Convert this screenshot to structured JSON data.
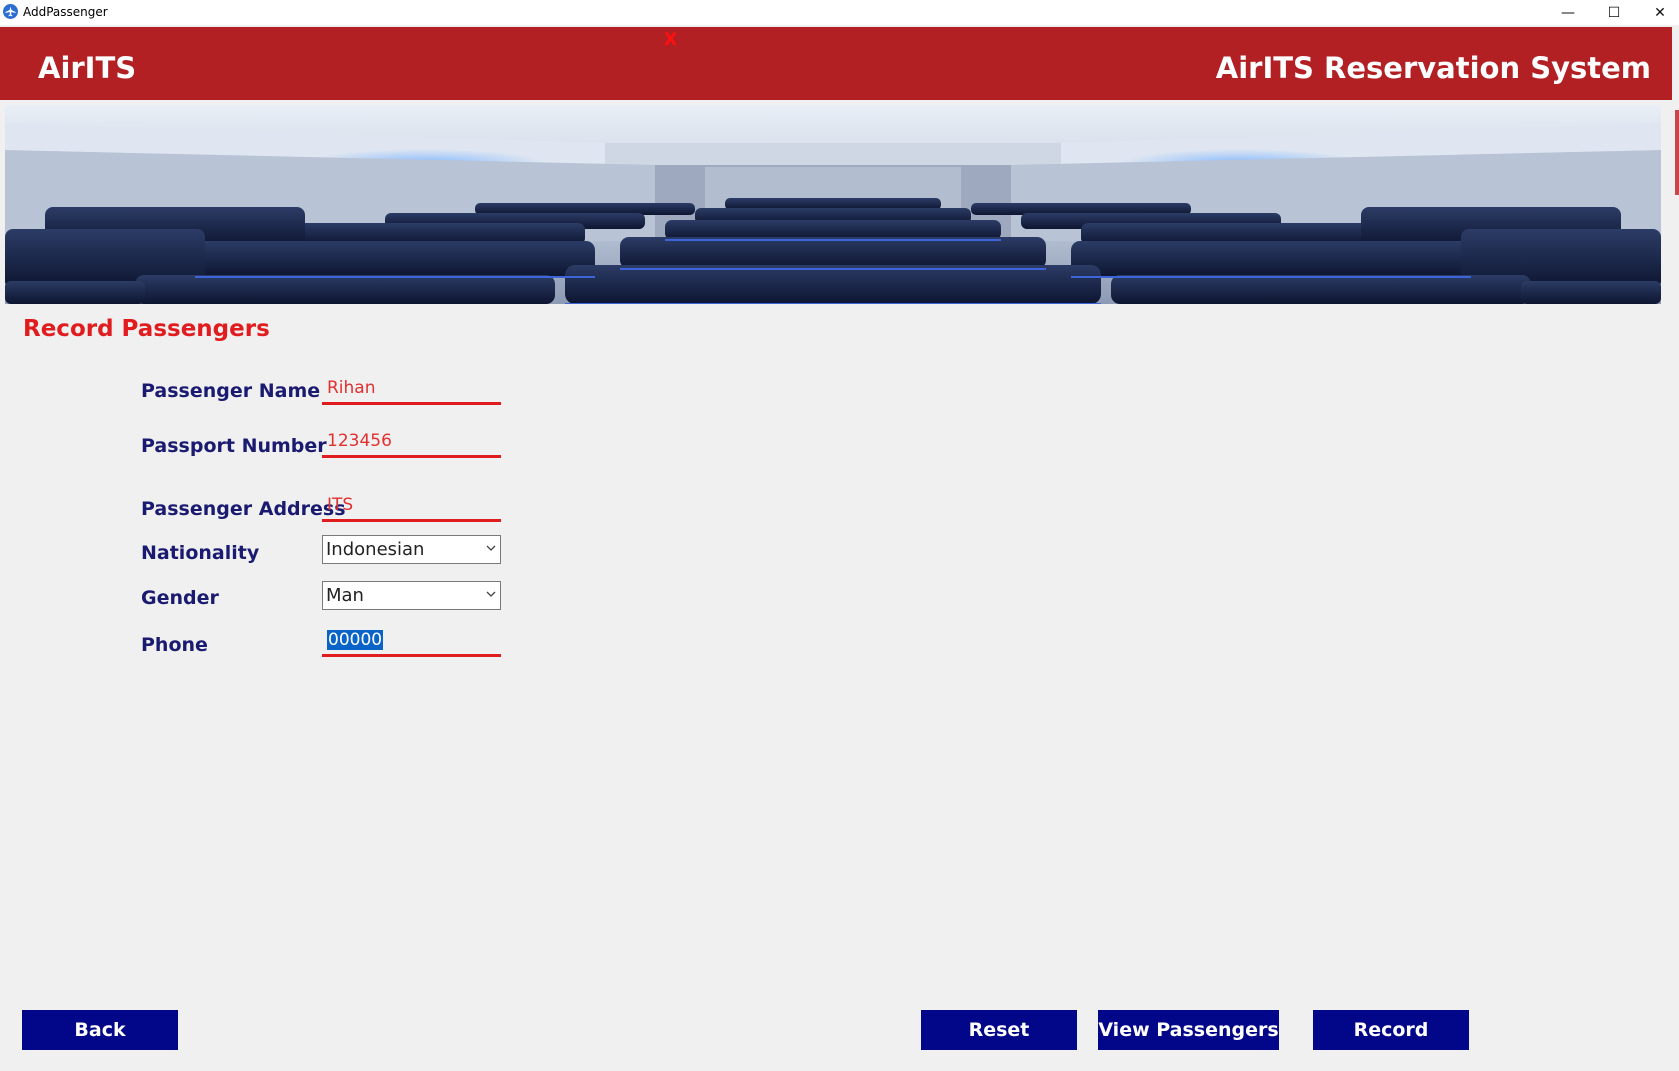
{
  "window": {
    "title": "AddPassenger",
    "minimize_glyph": "—",
    "maximize_glyph": "☐",
    "close_glyph": "✕"
  },
  "header": {
    "brand": "AirITS",
    "system_name": "AirITS Reservation System",
    "close_mark": "X"
  },
  "form": {
    "section_title": "Record Passengers",
    "fields": {
      "passenger_name": {
        "label": "Passenger Name",
        "value": "Rihan"
      },
      "passport_number": {
        "label": "Passport Number",
        "value": "123456"
      },
      "passenger_address": {
        "label": "Passenger Address",
        "value": "ITS"
      },
      "nationality": {
        "label": "Nationality",
        "value": "Indonesian"
      },
      "gender": {
        "label": "Gender",
        "value": "Man"
      },
      "phone": {
        "label": "Phone",
        "value": "00000"
      }
    }
  },
  "buttons": {
    "back": "Back",
    "reset": "Reset",
    "view_passengers": "View Passengers",
    "record": "Record"
  },
  "colors": {
    "header_bg": "#b22024",
    "accent_red": "#e11c1f",
    "label_navy": "#1a1a70",
    "button_bg": "#020688",
    "selection_blue": "#0a64c8"
  },
  "icons": {
    "app": "airplane-app-icon",
    "dropdown": "chevron-down-icon"
  }
}
